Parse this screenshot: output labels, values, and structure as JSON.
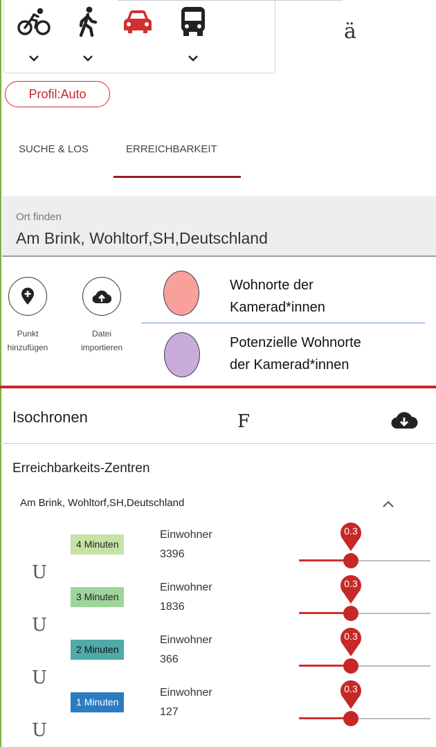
{
  "mode_bar": {
    "modes": [
      {
        "icon": "bicycle-icon",
        "has_dropdown": true
      },
      {
        "icon": "walking-icon",
        "has_dropdown": true
      },
      {
        "icon": "car-icon",
        "has_dropdown": false,
        "active": true
      },
      {
        "icon": "bus-icon",
        "has_dropdown": true
      }
    ],
    "stray_char": "ä"
  },
  "profile": {
    "label": "Profil:Auto"
  },
  "tabs": [
    {
      "label": "SUCHE & LOS",
      "active": false
    },
    {
      "label": "ERREICHBARKEIT",
      "active": true
    }
  ],
  "search": {
    "label": "Ort finden",
    "value": "Am Brink, Wohltorf,SH,Deutschland"
  },
  "actions": [
    {
      "icon": "add-location-icon",
      "label_line1": "Punkt",
      "label_line2": "hinzufügen"
    },
    {
      "icon": "cloud-upload-icon",
      "label_line1": "Datei",
      "label_line2": "importieren"
    }
  ],
  "legend": [
    {
      "color": "#f9a09a",
      "line1": "Wohnorte der",
      "line2": "Kamerad*innen"
    },
    {
      "color": "#c9acd9",
      "line1": "Potenzielle Wohnorte",
      "line2": "der Kamerad*innen"
    }
  ],
  "isochrones": {
    "title": "Isochronen",
    "stray_char": "F",
    "download_icon": "cloud-download-icon",
    "centers_title": "Erreichbarkeits-Zentren",
    "place": "Am Brink, Wohltorf,SH,Deutschland",
    "rows": [
      {
        "marker": "U",
        "badge": "4 Minuten",
        "badge_color": "#c5e3a5",
        "badge_text_color": "#222222",
        "pop_label": "Einwohner",
        "population": "3396",
        "slider_label": "0.3",
        "slider_value": 0.3
      },
      {
        "marker": "U",
        "badge": "3 Minuten",
        "badge_color": "#9ed59a",
        "badge_text_color": "#222222",
        "pop_label": "Einwohner",
        "population": "1836",
        "slider_label": "0.3",
        "slider_value": 0.3
      },
      {
        "marker": "U",
        "badge": "2 Minuten",
        "badge_color": "#50aaa8",
        "badge_text_color": "#111111",
        "pop_label": "Einwohner",
        "population": "366",
        "slider_label": "0.3",
        "slider_value": 0.3
      },
      {
        "marker": "U",
        "badge": "1 Minuten",
        "badge_color": "#2b7cc0",
        "badge_text_color": "#ffffff",
        "pop_label": "Einwohner",
        "population": "127",
        "slider_label": "0.3",
        "slider_value": 0.3
      }
    ]
  }
}
